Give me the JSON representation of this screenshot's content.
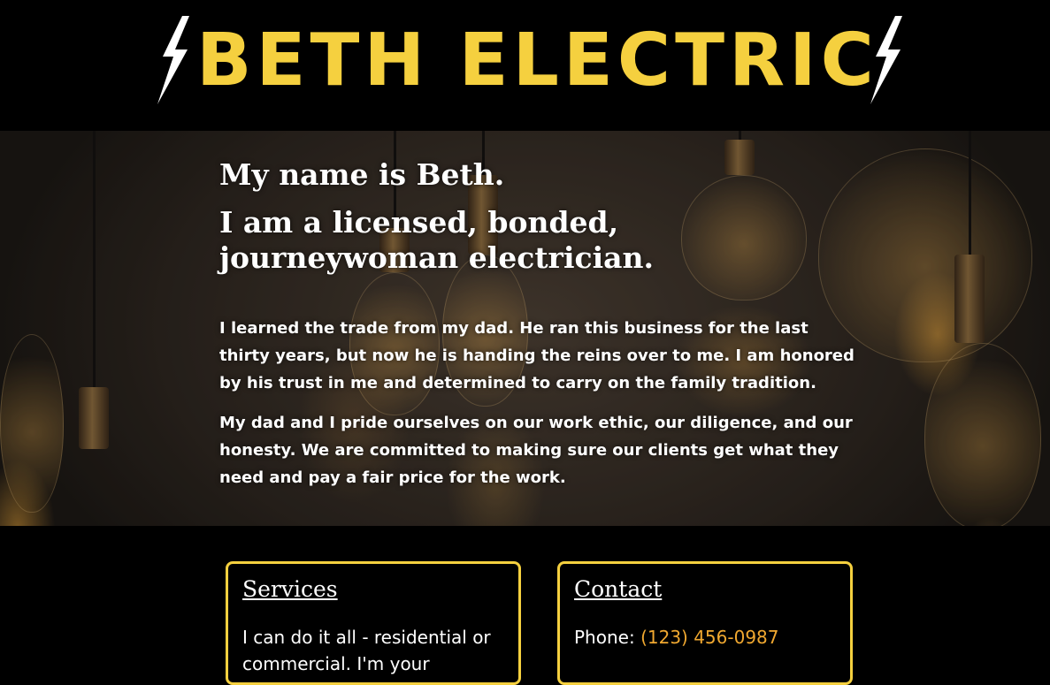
{
  "header": {
    "brand": "BETH ELECTRIC",
    "bolt_icon": "lightning-bolt-icon"
  },
  "hero": {
    "heading_name": "My name is Beth.",
    "heading_title": "I am a licensed, bonded, journeywoman electrician.",
    "paragraph_1": "I learned the trade from my dad. He ran this business for the last thirty years, but now he is handing the reins over to me. I am honored by his trust in me and determined to carry on the family tradition.",
    "paragraph_2": "My dad and I pride ourselves on our work ethic, our diligence, and our honesty. We are committed to making sure our clients get what they need and pay a fair price for the work."
  },
  "services": {
    "title": "Services",
    "text": "I can do it all - residential or commercial. I'm your"
  },
  "contact": {
    "title": "Contact",
    "phone_label": "Phone:",
    "phone_value": "(123) 456-0987"
  },
  "colors": {
    "brand_yellow": "#f5d03f",
    "phone_orange": "#f0a830",
    "background": "#000000"
  }
}
